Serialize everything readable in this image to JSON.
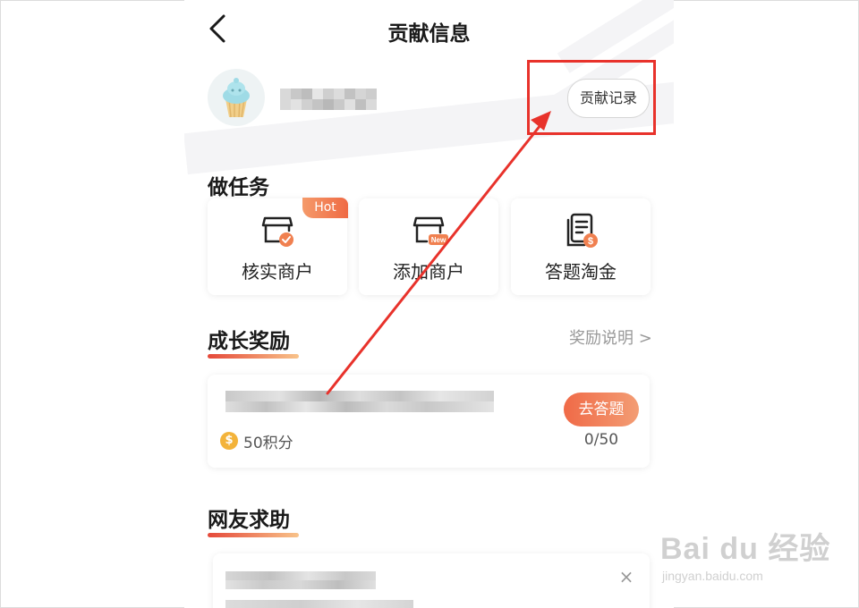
{
  "nav": {
    "title": "贡献信息"
  },
  "header": {
    "record_button": "贡献记录"
  },
  "tasks": {
    "title": "做任务",
    "items": [
      {
        "label": "核实商户",
        "badge": "Hot"
      },
      {
        "label": "添加商户",
        "icon_badge": "New"
      },
      {
        "label": "答题淘金"
      }
    ]
  },
  "growth": {
    "title": "成长奖励",
    "more_link": "奖励说明 >",
    "card": {
      "points": "50积分",
      "action_button": "去答题",
      "progress": "0/50"
    }
  },
  "help": {
    "title": "网友求助",
    "close_label": "×"
  },
  "watermark": {
    "main": "Bai du 经验",
    "sub": "jingyan.baidu.com"
  },
  "colors": {
    "accent": "#f06a47",
    "annotation_red": "#e8322b"
  }
}
